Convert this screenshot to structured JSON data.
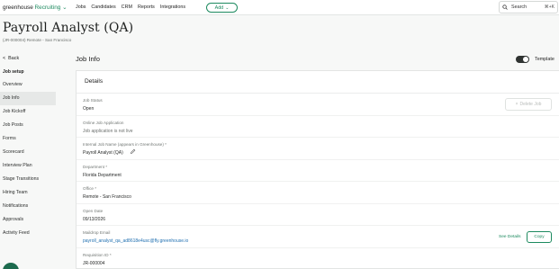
{
  "topbar": {
    "brand_main": "greenhouse",
    "brand_accent": "Recruiting",
    "brand_chevron": "⌄",
    "nav": [
      "Jobs",
      "Candidates",
      "CRM",
      "Reports",
      "Integrations"
    ],
    "add_label": "Add",
    "add_chevron": "⌄",
    "search_label": "Search",
    "search_shortcut": "⌘+K"
  },
  "header": {
    "title": "Payroll Analyst (QA)",
    "subtitle": "(JR-000004) Remote - San Francisco"
  },
  "sidebar": {
    "back_label": "Back",
    "back_glyph": "<",
    "section": "Job setup",
    "items": [
      "Overview",
      "Job Info",
      "Job Kickoff",
      "Job Posts",
      "Forms",
      "Scorecard",
      "Interview Plan",
      "Stage Transitions",
      "Hiring Team",
      "Notifications",
      "Approvals",
      "Activity Feed"
    ],
    "active_index": 1
  },
  "main": {
    "section_title": "Job Info",
    "template_label": "Template",
    "template_on": true,
    "card_title": "Details",
    "delete_label": "Delete Job",
    "delete_glyph": "×",
    "fields": [
      {
        "label": "Job Status",
        "value": "Open"
      },
      {
        "label": "Online Job Application",
        "value": "Job application is not live"
      },
      {
        "label": "Internal Job Name (appears in Greenhouse) *",
        "value": "Payroll Analyst (QA)"
      },
      {
        "label": "Department *",
        "value": "Florida Department"
      },
      {
        "label": "Office *",
        "value": "Remote - San Francisco"
      },
      {
        "label": "Open Date",
        "value": "09/13/2026"
      },
      {
        "label": "Maildrop Email",
        "value": "payroll_analyst_qa_ad8618e4usc@fly.greenhouse.io"
      },
      {
        "label": "Requisition ID *",
        "value": "JR-000004"
      }
    ],
    "see_details_label": "See Details",
    "copy_label": "Copy"
  },
  "colors": {
    "accent": "#1d8a5f",
    "link": "#1f6fb0"
  }
}
